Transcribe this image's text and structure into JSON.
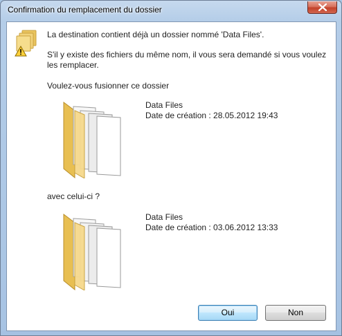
{
  "window": {
    "title": "Confirmation du remplacement du dossier"
  },
  "message": {
    "line1": "La destination contient déjà un dossier nommé 'Data Files'.",
    "line2": "S'il y existe des fichiers du même nom, il vous sera demandé si vous voulez les remplacer.",
    "question": "Voulez-vous fusionner ce dossier",
    "with_label": "avec celui-ci ?"
  },
  "source_folder": {
    "name": "Data Files",
    "date": "Date de création : 28.05.2012 19:43"
  },
  "destination_folder": {
    "name": "Data Files",
    "date": "Date de création : 03.06.2012 13:33"
  },
  "buttons": {
    "yes": "Oui",
    "no": "Non"
  },
  "colors": {
    "title_bar": "#b4cde8",
    "close_button": "#c3422a",
    "folder": "#f3d27a",
    "default_button_border": "#3c7fb1"
  },
  "icons": {
    "warning": "warning-folders-icon",
    "close": "close-icon",
    "folder": "folder-icon"
  }
}
